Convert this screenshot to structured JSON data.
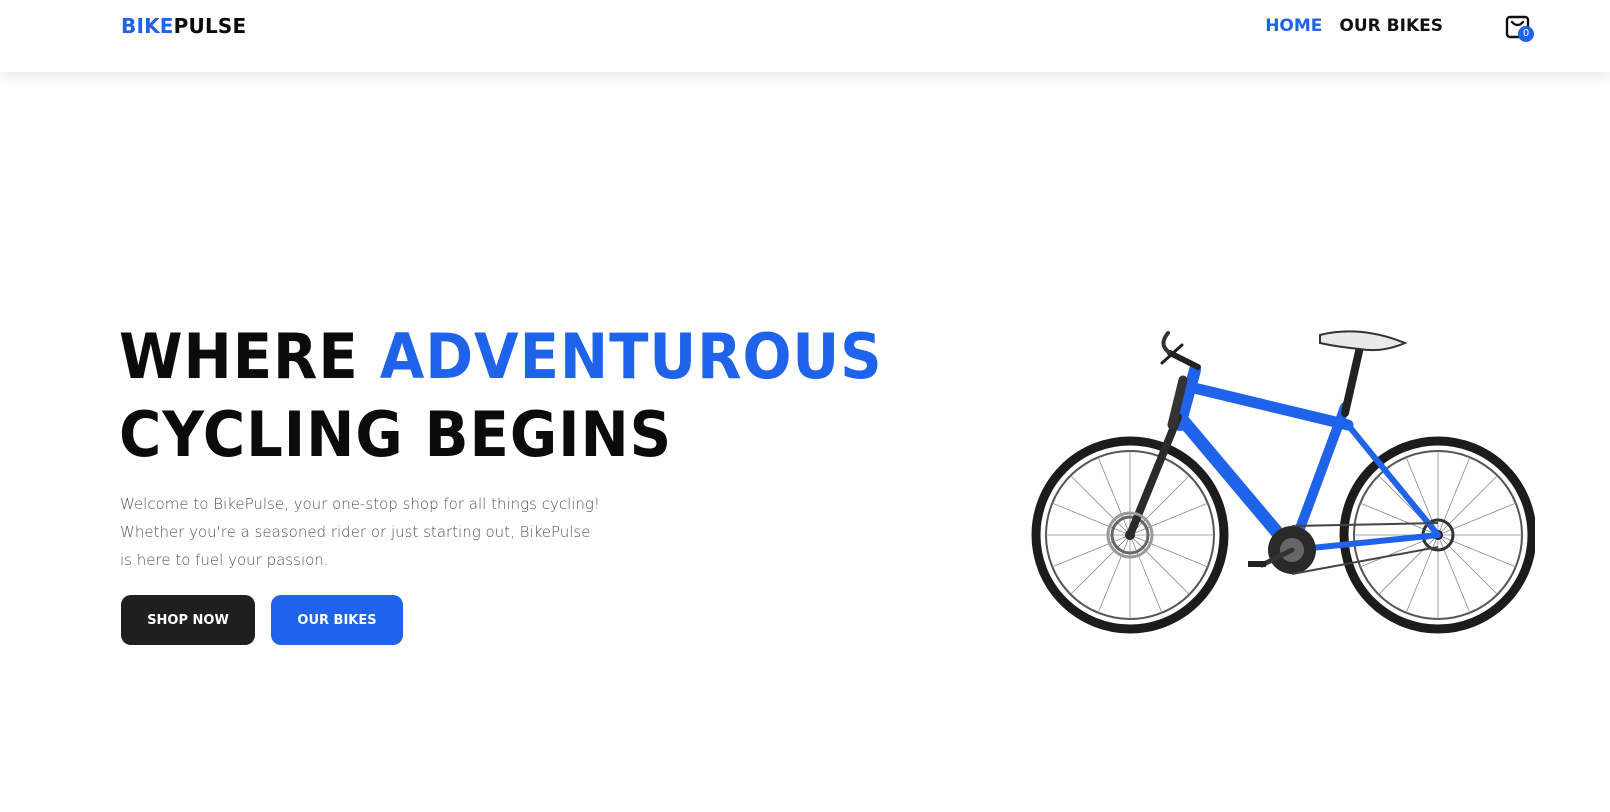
{
  "brand": {
    "part1": "BIKE",
    "part2": "PULSE"
  },
  "nav": {
    "home": "HOME",
    "our_bikes": "OUR BIKES",
    "cart_count": "0"
  },
  "hero": {
    "title_part1": "WHERE ",
    "title_accent": "ADVENTUROUS",
    "title_line2": "CYCLING BEGINS",
    "description": "Welcome to BikePulse, your one-stop shop for all things cycling! Whether you're a seasoned rider or just starting out, BikePulse is here to fuel your passion.",
    "shop_now_label": "SHOP NOW",
    "our_bikes_label": "OUR BIKES"
  },
  "colors": {
    "accent": "#1f63ea",
    "dark_button": "#1f1f1f",
    "text": "#0b0b0b"
  },
  "icons": {
    "cart": "cart-icon",
    "hero_image": "bicycle-image"
  }
}
